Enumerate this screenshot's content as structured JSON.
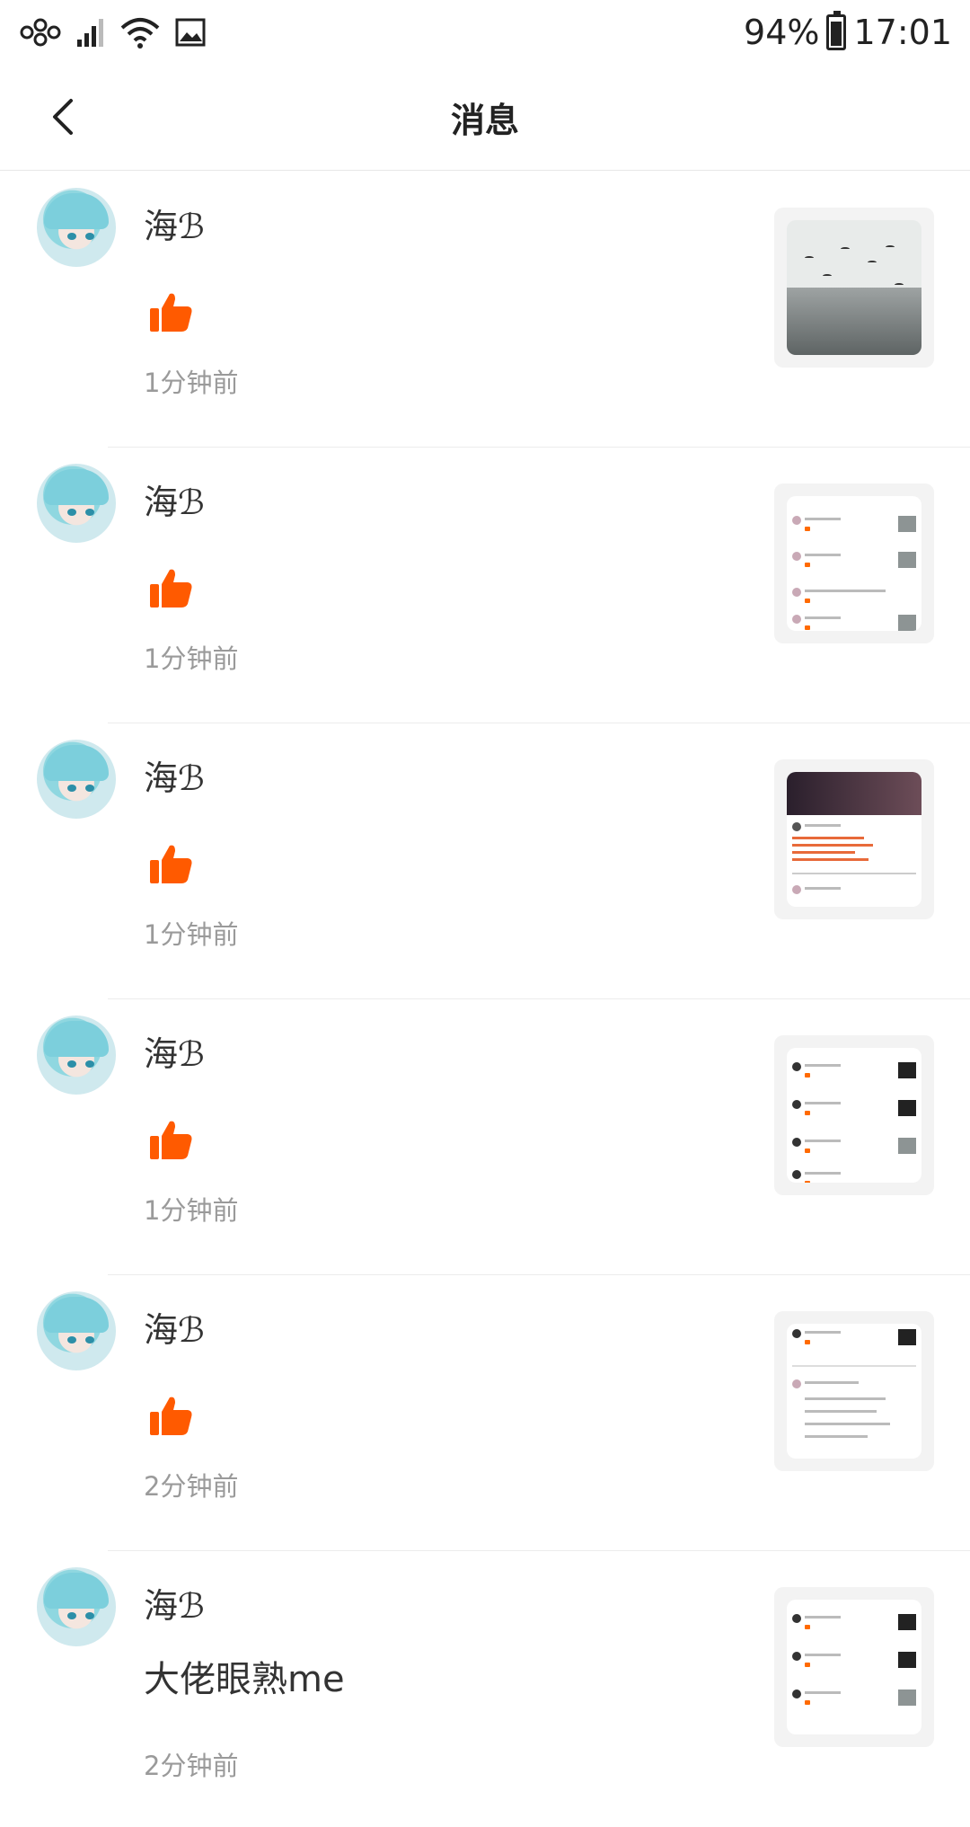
{
  "status_bar": {
    "battery": "94%",
    "time": "17:01",
    "icons": [
      "network-logo-icon",
      "signal-icon",
      "wifi-icon",
      "gallery-icon",
      "battery-icon"
    ],
    "battery_level": 0.94
  },
  "header": {
    "title": "消息",
    "back_icon": "chevron-left-icon"
  },
  "colors": {
    "like": "#ff5a00",
    "time_text": "#9a9a9a",
    "divider": "#ececec"
  },
  "messages": [
    {
      "user": "海ℬ",
      "type": "like",
      "time": "1分钟前",
      "thumbnail": "seagull-photo"
    },
    {
      "user": "海ℬ",
      "type": "like",
      "time": "1分钟前",
      "thumbnail": "likes-list-screenshot"
    },
    {
      "user": "海ℬ",
      "type": "like",
      "time": "1分钟前",
      "thumbnail": "game-page-screenshot"
    },
    {
      "user": "海ℬ",
      "type": "like",
      "time": "1分钟前",
      "thumbnail": "likes-list-screenshot"
    },
    {
      "user": "海ℬ",
      "type": "like",
      "time": "2分钟前",
      "thumbnail": "comments-screenshot"
    },
    {
      "user": "海ℬ",
      "type": "comment",
      "text": "大佬眼熟me",
      "time": "2分钟前",
      "thumbnail": "likes-list-screenshot"
    }
  ]
}
